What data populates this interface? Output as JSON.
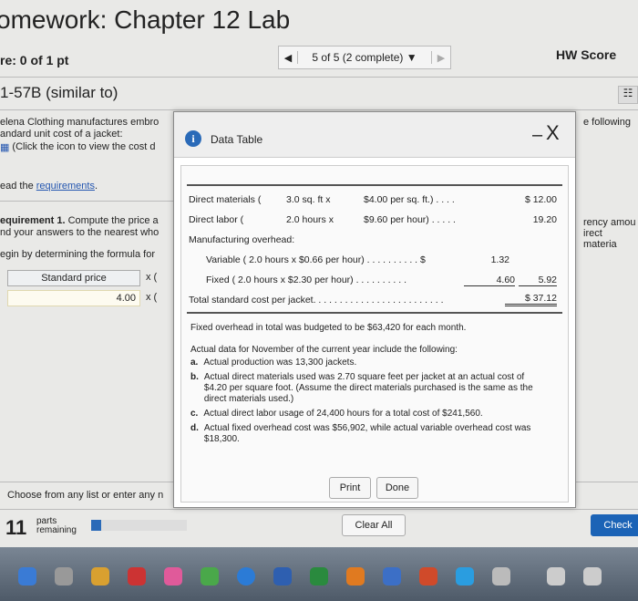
{
  "header": {
    "title": "omework: Chapter 12 Lab",
    "score": "re: 0 of 1 pt",
    "nav_status": "5 of 5 (2 complete) ▼",
    "hw_score": "HW Score",
    "question_id": "1-57B (similar to)"
  },
  "left": {
    "line1": "elena Clothing manufactures embro",
    "line2": "andard unit cost of a jacket:",
    "line3": "(Click the icon to view the cost d",
    "read_prefix": "ead the ",
    "read_link": "requirements",
    "read_suffix": ".",
    "req_bold": "equirement 1.",
    "req_rest": " Compute the price a",
    "req_line2": "nd your answers to the nearest who",
    "begin": "egin by determining the formula for",
    "standard_price": "Standard price",
    "times1": "x (",
    "value": "4.00",
    "times2": "x (",
    "choose": "Choose from any list or enter any n",
    "parts_num": "11",
    "parts_label1": "parts",
    "parts_label2": "remaining",
    "progress_fraction": 0.1,
    "clear_all": "Clear All",
    "check": "Check"
  },
  "right": {
    "following": "e following",
    "rency": "rency amou",
    "irect": "irect materia"
  },
  "modal": {
    "title": "Data Table",
    "min": "–",
    "close": "X",
    "rows": [
      {
        "label": "Direct materials (",
        "qty": "3.0  sq. ft x",
        "rate": "$4.00   per sq. ft.)  . . . .",
        "sub": "",
        "total": "$   12.00"
      },
      {
        "label": "Direct labor      (",
        "qty": "2.0  hours x",
        "rate": "$9.60   per hour)  . . . . .",
        "sub": "",
        "total": "19.20"
      }
    ],
    "mo": "Manufacturing overhead:",
    "var": {
      "label": "Variable  (   2.0  hours x   $0.66 per hour) . . . . . . . . . .  $",
      "sub": "1.32"
    },
    "fix": {
      "label": "Fixed       ( 2.0  hours x   $2.30 per hour) . . . . . . . . . .",
      "sub": "4.60",
      "total": "5.92"
    },
    "tot": {
      "label": "Total standard cost per jacket. . . . . . . . . . . . . . . . . . . . . . . . .",
      "total": "$  37.12"
    },
    "fixed_budget": "Fixed overhead in total was budgeted to be $63,420 for each month.",
    "actual_intro": "Actual data for November of the current year include the following:",
    "items": [
      {
        "k": "a.",
        "t": "Actual production was 13,300 jackets."
      },
      {
        "k": "b.",
        "t": "Actual direct materials used was 2.70 square feet per jacket at an actual cost of $4.20 per square foot. (Assume the direct materials purchased is the same as the direct materials used.)"
      },
      {
        "k": "c.",
        "t": "Actual direct labor usage of 24,400 hours for a total cost of $241,560."
      },
      {
        "k": "d.",
        "t": "Actual fixed overhead cost was $56,902, while actual variable overhead cost was $18,300."
      }
    ],
    "print": "Print",
    "done": "Done"
  }
}
